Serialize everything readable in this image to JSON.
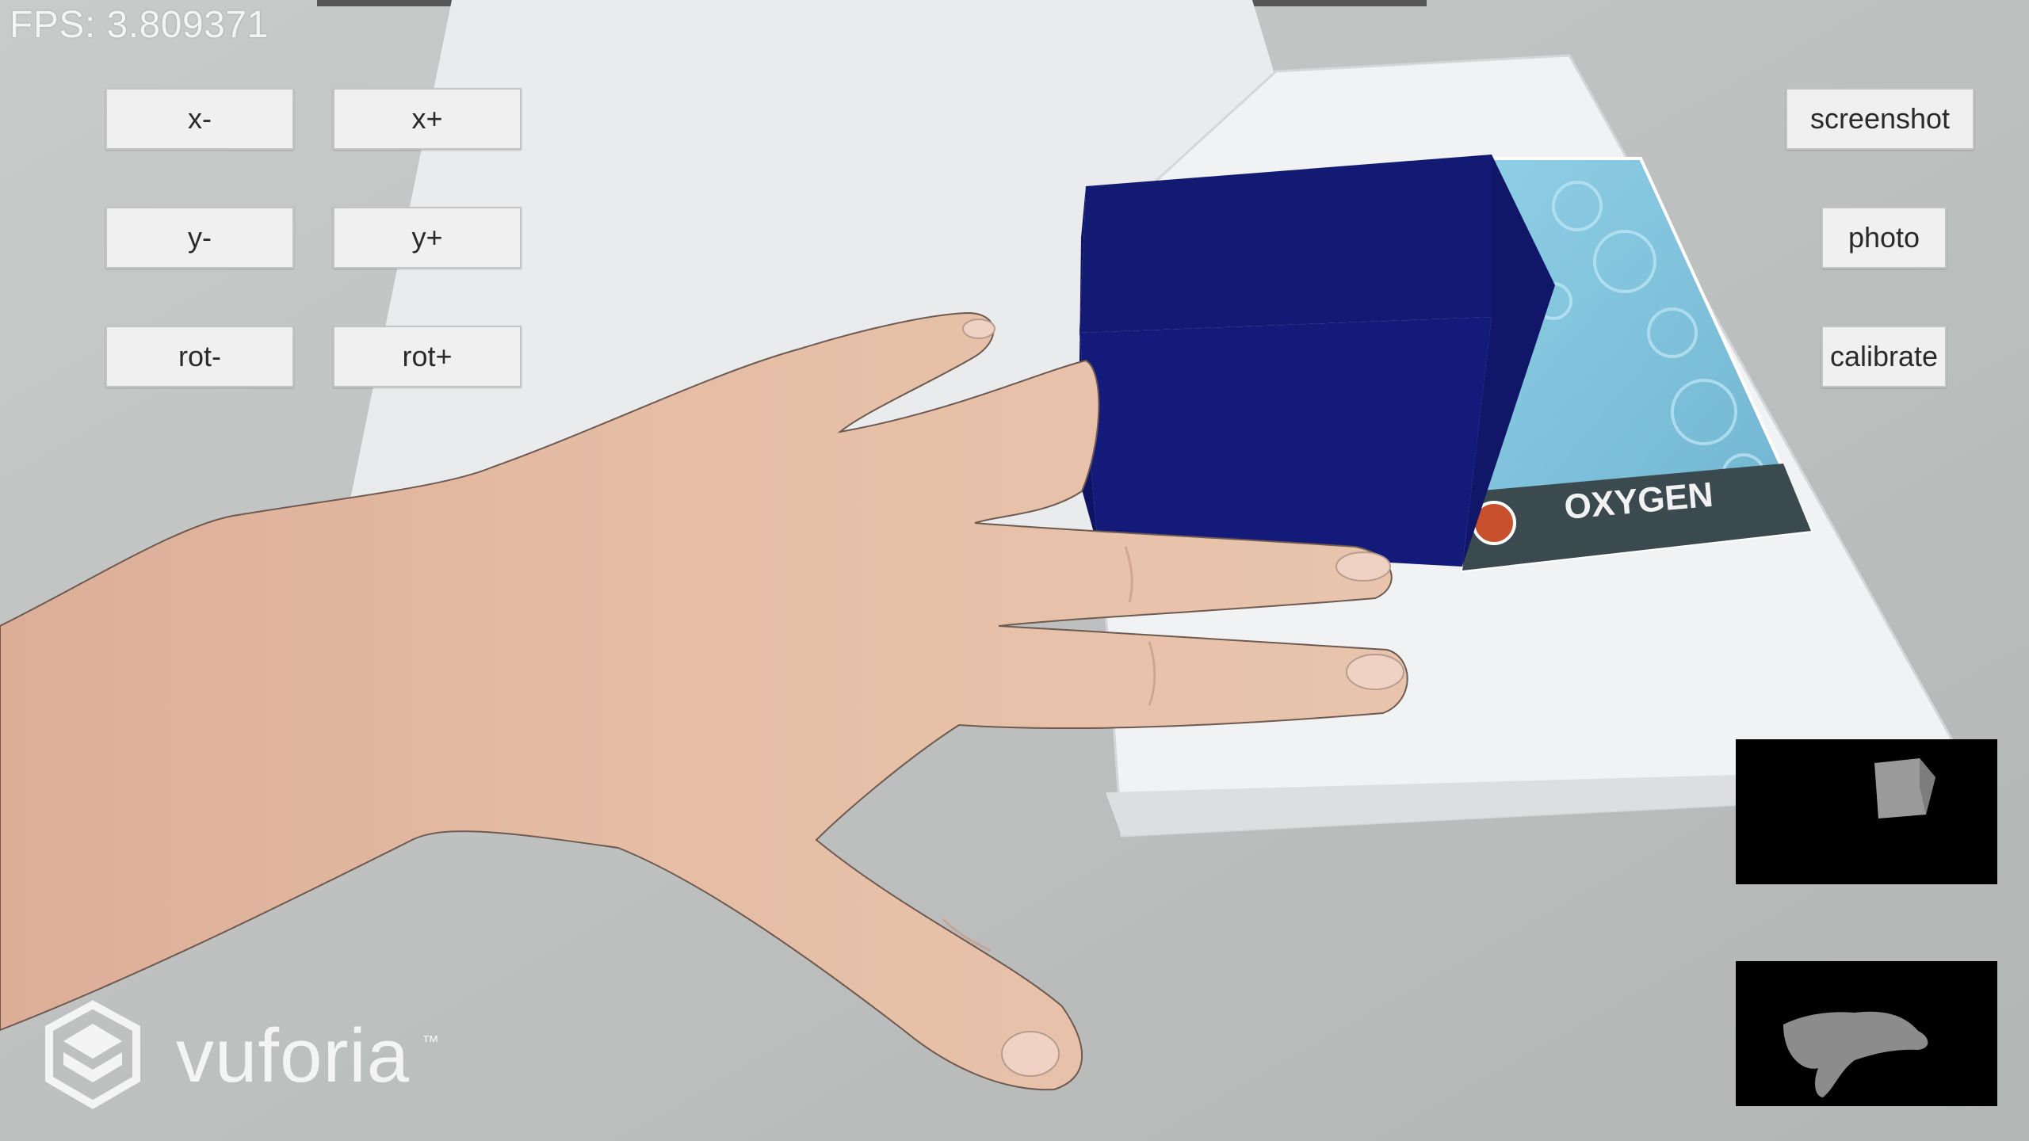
{
  "status": {
    "fps_text": "FPS: 3.809371"
  },
  "controls": {
    "x_minus": "x-",
    "x_plus": "x+",
    "y_minus": "y-",
    "y_plus": "y+",
    "rot_minus": "rot-",
    "rot_plus": "rot+"
  },
  "actions": {
    "screenshot": "screenshot",
    "photo": "photo",
    "calibrate": "calibrate"
  },
  "scene": {
    "marker_label": "OXYGEN",
    "cube_color": "#141a78"
  },
  "branding": {
    "name": "vuforia",
    "trademark": "™"
  },
  "colors": {
    "button_bg": "#f0f0f0",
    "table": "#bdbfbe",
    "paper": "#eef0f1",
    "skin": "#e3b89f"
  }
}
